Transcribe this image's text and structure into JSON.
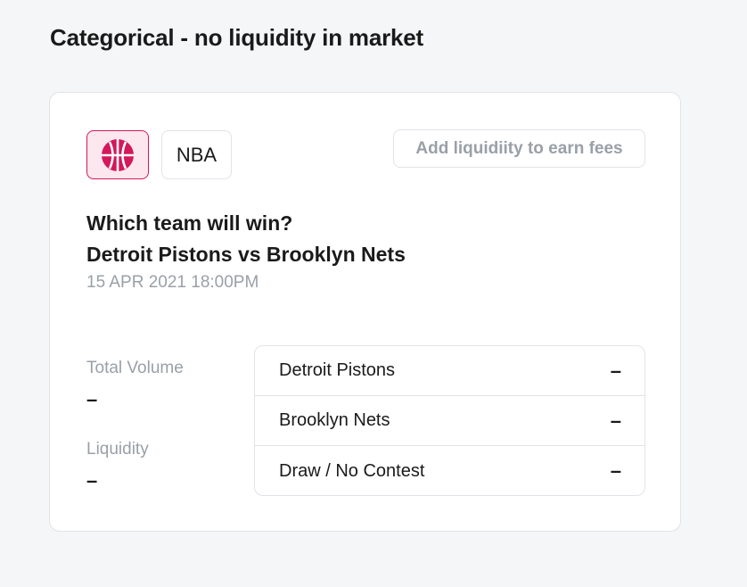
{
  "page": {
    "title": "Categorical - no liquidity in market"
  },
  "card": {
    "category_icon": "basketball-icon",
    "accent_color": "#d4185a",
    "league": "NBA",
    "liquidity_button_label": "Add liquidiity to earn fees",
    "question_line1": "Which team will win?",
    "question_line2": "Detroit Pistons vs Brooklyn Nets",
    "date": "15 APR 2021 18:00PM",
    "stats": {
      "total_volume_label": "Total Volume",
      "total_volume_value": "–",
      "liquidity_label": "Liquidity",
      "liquidity_value": "–"
    },
    "outcomes": [
      {
        "name": "Detroit Pistons",
        "value": "–"
      },
      {
        "name": "Brooklyn Nets",
        "value": "–"
      },
      {
        "name": "Draw / No Contest",
        "value": "–"
      }
    ]
  }
}
